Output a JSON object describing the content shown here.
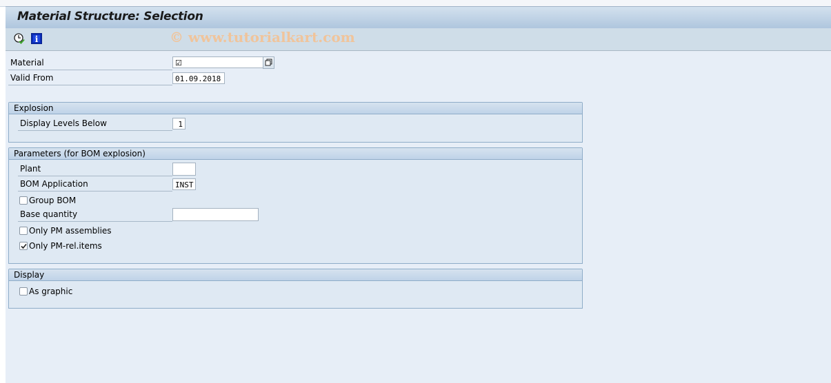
{
  "window": {
    "title": "Material Structure: Selection"
  },
  "toolbar": {
    "buttons": [
      {
        "icon": "execute-clock-icon",
        "tooltip": "Execute"
      },
      {
        "icon": "info-icon",
        "label": "i"
      }
    ],
    "watermark": "© www.tutorialkart.com"
  },
  "header_fields": {
    "material": {
      "label": "Material",
      "value": "",
      "required_indicator": "☑"
    },
    "valid_from": {
      "label": "Valid From",
      "value": "01.09.2018"
    }
  },
  "groups": {
    "explosion": {
      "title": "Explosion",
      "display_levels_below": {
        "label": "Display Levels Below",
        "value": "1"
      }
    },
    "parameters": {
      "title": "Parameters (for BOM explosion)",
      "plant": {
        "label": "Plant",
        "value": ""
      },
      "bom_application": {
        "label": "BOM Application",
        "value": "INST"
      },
      "group_bom": {
        "label": "Group BOM",
        "checked": false
      },
      "base_quantity": {
        "label": "Base quantity",
        "value": ""
      },
      "only_pm_assemblies": {
        "label": "Only PM assemblies",
        "checked": false
      },
      "only_pm_rel_items": {
        "label": "Only PM-rel.items",
        "checked": true
      }
    },
    "display": {
      "title": "Display",
      "as_graphic": {
        "label": "As graphic",
        "checked": false
      }
    }
  }
}
